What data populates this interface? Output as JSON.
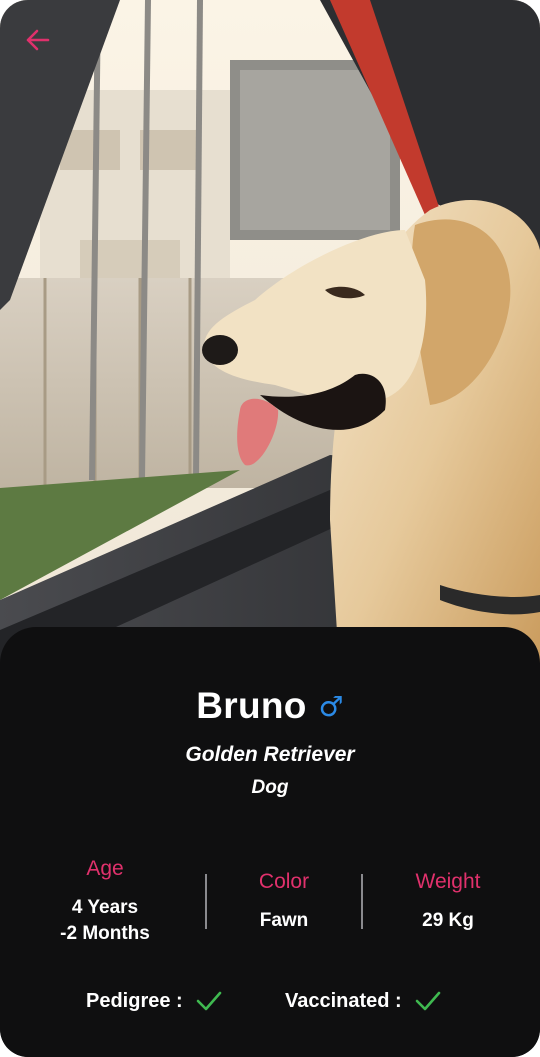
{
  "header": {
    "back_icon": "arrow-left-icon",
    "accent_color": "#e0316c"
  },
  "photo": {
    "subject_icon": "dog-photo"
  },
  "pet": {
    "name": "Bruno",
    "gender_symbol": "♂",
    "gender_color": "#2b8ae6",
    "breed": "Golden Retriever",
    "species": "Dog"
  },
  "stats": {
    "age_label": "Age",
    "age_value_line1": "4 Years",
    "age_value_line2": "-2 Months",
    "color_label": "Color",
    "color_value": "Fawn",
    "weight_label": "Weight",
    "weight_value": "29 Kg"
  },
  "flags": {
    "pedigree_label": "Pedigree :",
    "pedigree_checked": true,
    "vaccinated_label": "Vaccinated :",
    "vaccinated_checked": true,
    "check_color": "#3fb950"
  }
}
